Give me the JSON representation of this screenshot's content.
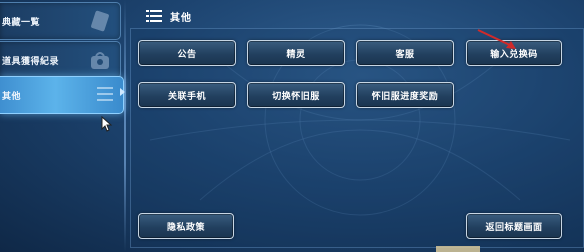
{
  "sidebar": {
    "items": [
      {
        "label": "典藏一覧",
        "active": false
      },
      {
        "label": "道具獲得紀录",
        "active": false
      },
      {
        "label": "其他",
        "active": true
      }
    ]
  },
  "header": {
    "title": "其他",
    "icon": "menu-icon"
  },
  "buttons": {
    "notice": "公告",
    "spirit": "精灵",
    "support": "客服",
    "redeem_code": "输入兑换码",
    "link_phone": "关联手机",
    "switch_server": "切换怀旧服",
    "server_progress_reward": "怀旧服进度奖励",
    "privacy_policy": "隐私政策",
    "return_title": "返回标题画面"
  },
  "colors": {
    "background": "#1d4470",
    "active_tab": "#5cb3ea",
    "button_border": "#c7d6e4",
    "annotation_arrow": "#d02a2a"
  }
}
